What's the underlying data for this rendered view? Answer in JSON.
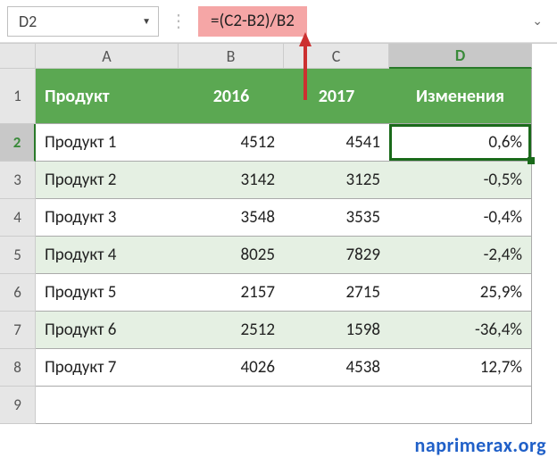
{
  "toolbar": {
    "name_box": "D2",
    "formula": "=(C2-B2)/B2"
  },
  "columns": [
    "A",
    "B",
    "C",
    "D"
  ],
  "headers": {
    "product": "Продукт",
    "y2016": "2016",
    "y2017": "2017",
    "change": "Изменения"
  },
  "rows": [
    {
      "n": "2",
      "product": "Продукт 1",
      "y2016": "4512",
      "y2017": "4541",
      "change": "0,6%"
    },
    {
      "n": "3",
      "product": "Продукт 2",
      "y2016": "3142",
      "y2017": "3125",
      "change": "-0,5%"
    },
    {
      "n": "4",
      "product": "Продукт 3",
      "y2016": "3548",
      "y2017": "3535",
      "change": "-0,4%"
    },
    {
      "n": "5",
      "product": "Продукт 4",
      "y2016": "8025",
      "y2017": "7829",
      "change": "-2,4%"
    },
    {
      "n": "6",
      "product": "Продукт 5",
      "y2016": "2157",
      "y2017": "2715",
      "change": "25,9%"
    },
    {
      "n": "7",
      "product": "Продукт 6",
      "y2016": "2512",
      "y2017": "1598",
      "change": "-36,4%"
    },
    {
      "n": "8",
      "product": "Продукт 7",
      "y2016": "4026",
      "y2017": "4538",
      "change": "12,7%"
    }
  ],
  "row9": "9",
  "row1": "1",
  "watermark": "naprimerax.org",
  "chart_data": {
    "type": "table",
    "title": "",
    "columns": [
      "Продукт",
      "2016",
      "2017",
      "Изменения"
    ],
    "data": [
      [
        "Продукт 1",
        4512,
        4541,
        "0,6%"
      ],
      [
        "Продукт 2",
        3142,
        3125,
        "-0,5%"
      ],
      [
        "Продукт 3",
        3548,
        3535,
        "-0,4%"
      ],
      [
        "Продукт 4",
        8025,
        7829,
        "-2,4%"
      ],
      [
        "Продукт 5",
        2157,
        2715,
        "25,9%"
      ],
      [
        "Продукт 6",
        2512,
        1598,
        "-36,4%"
      ],
      [
        "Продукт 7",
        4026,
        4538,
        "12,7%"
      ]
    ]
  }
}
